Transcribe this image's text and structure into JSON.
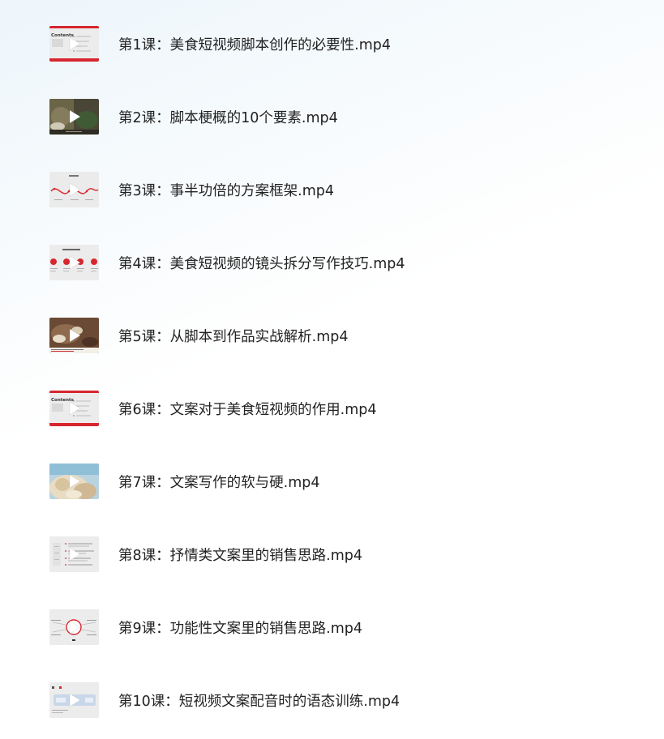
{
  "lessons": [
    {
      "title": "第1课：美食短视频脚本创作的必要性.mp4",
      "thumb": "contents-slide"
    },
    {
      "title": "第2课：脚本梗概的10个要素.mp4",
      "thumb": "food-photo-dark"
    },
    {
      "title": "第3课：事半功倍的方案框架.mp4",
      "thumb": "wave-diagram-slide"
    },
    {
      "title": "第4课：美食短视频的镜头拆分写作技巧.mp4",
      "thumb": "four-circles-slide"
    },
    {
      "title": "第5课：从脚本到作品实战解析.mp4",
      "thumb": "food-photo-warm"
    },
    {
      "title": "第6课：文案对于美食短视频的作用.mp4",
      "thumb": "contents-slide"
    },
    {
      "title": "第7课：文案写作的软与硬.mp4",
      "thumb": "food-photo-light"
    },
    {
      "title": "第8课：抒情类文案里的销售思路.mp4",
      "thumb": "text-list-slide"
    },
    {
      "title": "第9课：功能性文案里的销售思路.mp4",
      "thumb": "center-diagram-slide"
    },
    {
      "title": "第10课：短视频文案配音时的语态训练.mp4",
      "thumb": "blue-bar-slide"
    }
  ],
  "play_icon": "play-icon",
  "colors": {
    "accent_red": "#d7262e",
    "title_text": "#222222"
  }
}
